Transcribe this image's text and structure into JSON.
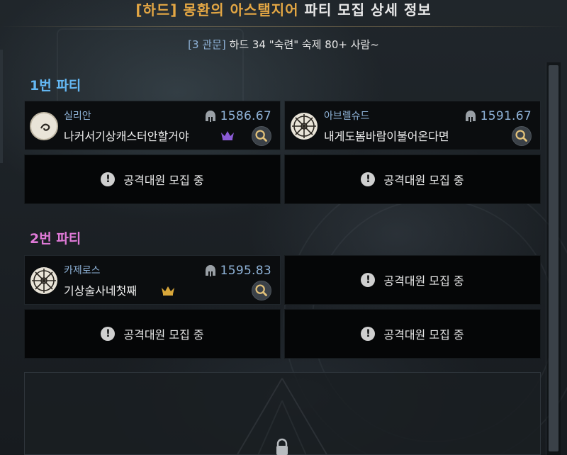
{
  "header": {
    "title_accent": "[하드] 몽환의 아스탤지어",
    "title_rest": "파티 모집 상세 정보",
    "subtitle_tag": "[3 관문]",
    "subtitle_body": "하드 34 \"숙련\" 숙제 80+ 사람~"
  },
  "colors": {
    "accent": "#e4a744",
    "party1": "#64b8f4",
    "party2": "#e07ad8",
    "class_text": "#8fb3d8",
    "slot_bg": "#050607"
  },
  "empty_label": "공격대원 모집 중",
  "parties": [
    {
      "label": "1번 파티",
      "members": [
        {
          "class": "실리안",
          "name": "나커서기상캐스터안할거야",
          "gear_score": "1586.67",
          "badge": "purple-crown-icon",
          "icon": "moon-swirl-icon"
        },
        {
          "class": "아브렐슈드",
          "name": "내게도봄바람이불어온다면",
          "gear_score": "1591.67",
          "badge": "",
          "icon": "sun-wheel-icon"
        }
      ]
    },
    {
      "label": "2번 파티",
      "members": [
        {
          "class": "카제로스",
          "name": "기상술사네첫째",
          "gear_score": "1595.83",
          "badge": "gold-crown-icon",
          "icon": "sun-wheel-icon"
        }
      ]
    }
  ]
}
